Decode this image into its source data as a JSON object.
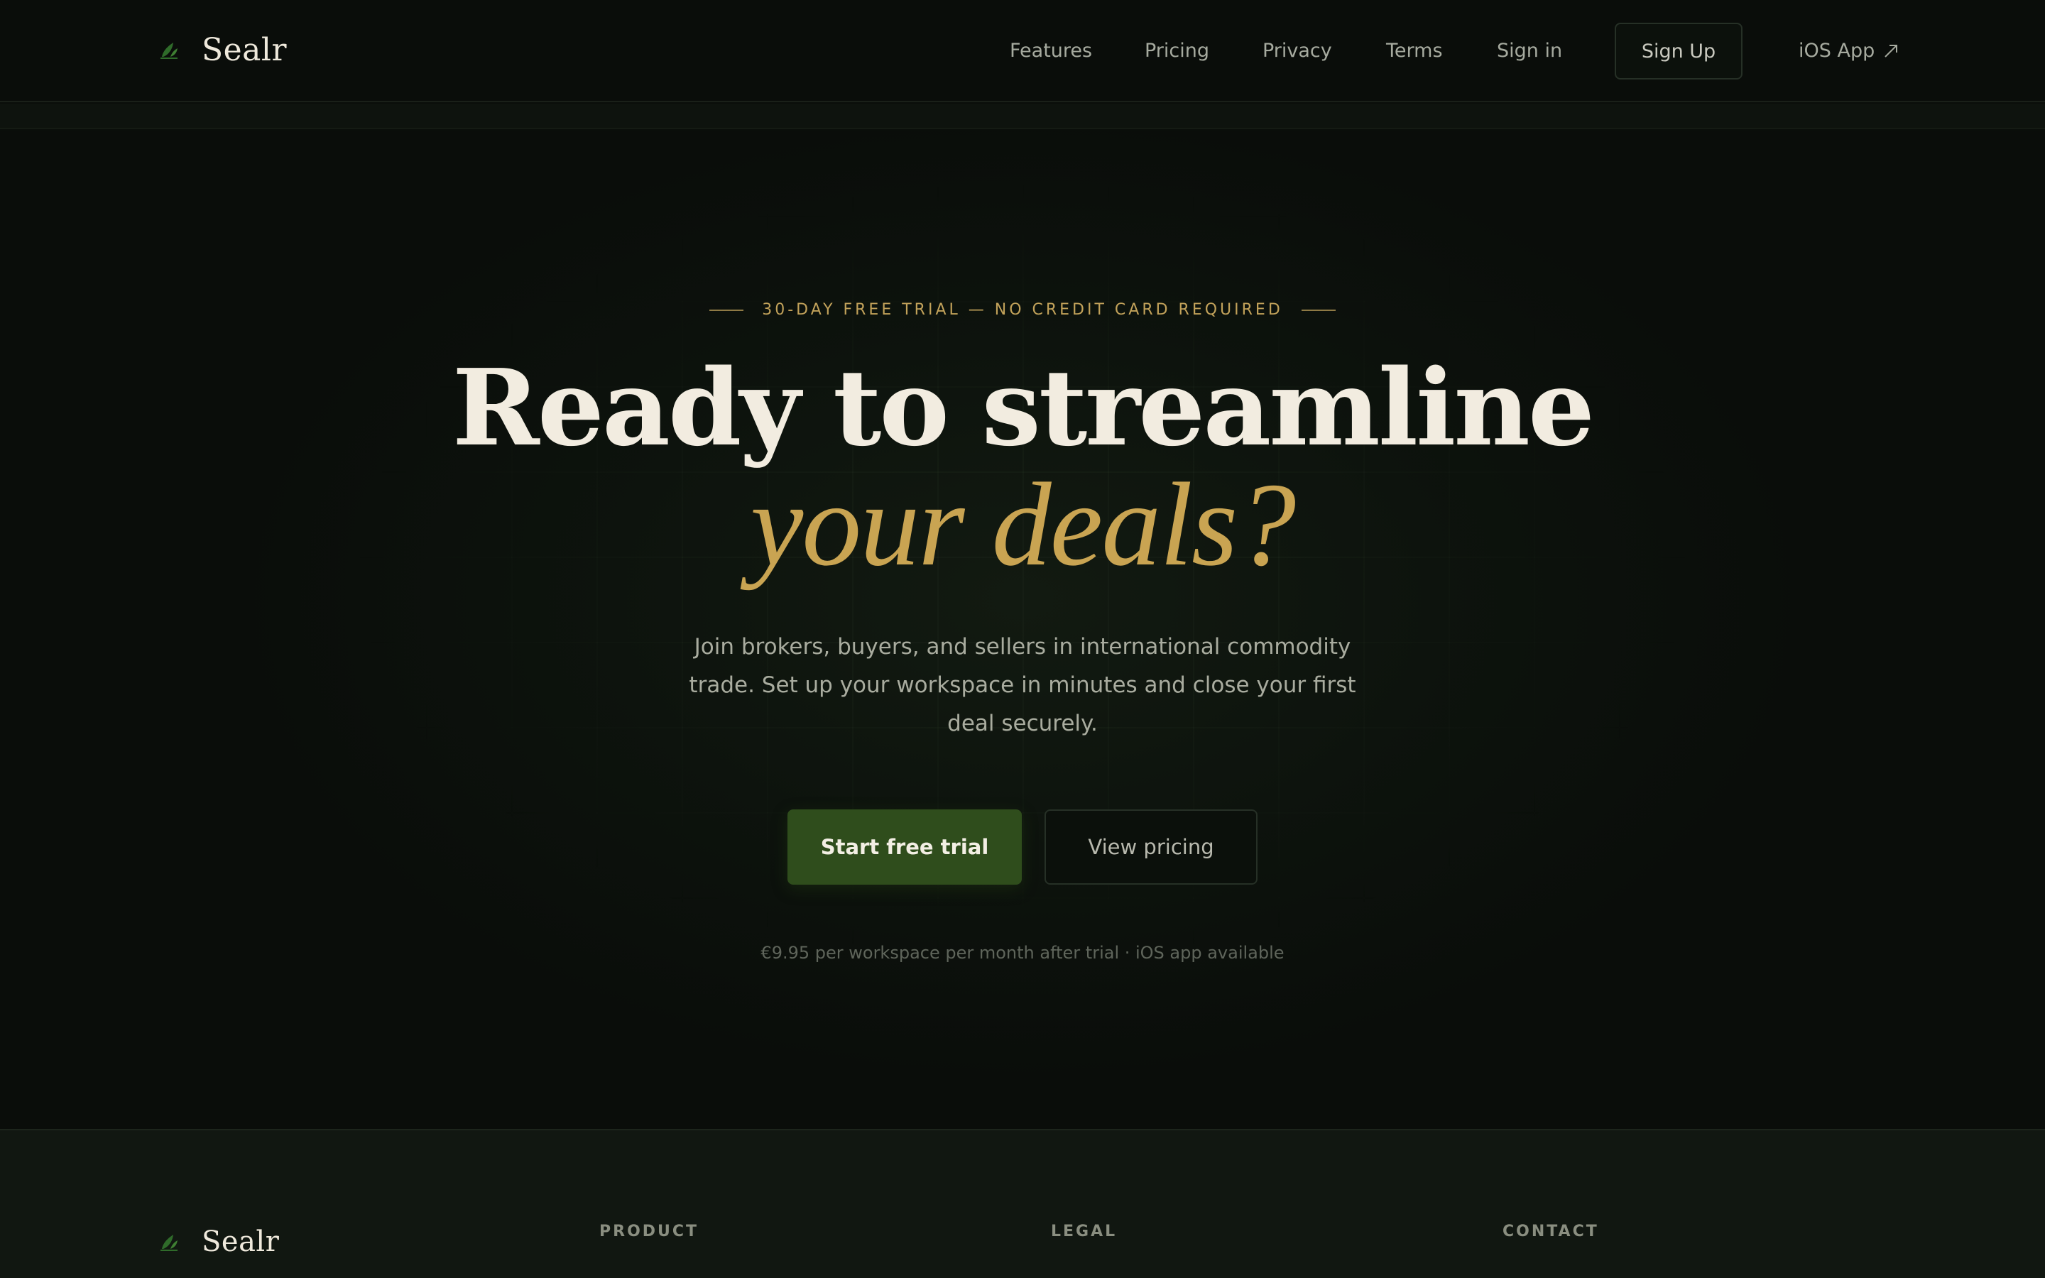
{
  "nav": {
    "brand": "Sealr",
    "links": {
      "features": "Features",
      "pricing": "Pricing",
      "privacy": "Privacy",
      "terms": "Terms",
      "signin": "Sign in"
    },
    "signup_label": "Sign Up",
    "ios_label": "iOS App"
  },
  "hero": {
    "eyebrow": "30-DAY FREE TRIAL — NO CREDIT CARD REQUIRED",
    "headline": "Ready to streamline",
    "headline_accent": "your deals?",
    "subtext": "Join brokers, buyers, and sellers in international commodity trade. Set up your workspace in minutes and close your first deal securely.",
    "primary_cta": "Start free trial",
    "secondary_cta": "View pricing",
    "fineprint": "€9.95 per workspace per month after trial · iOS app available"
  },
  "footer": {
    "brand": "Sealr",
    "columns": {
      "product": "PRODUCT",
      "legal": "LEGAL",
      "contact": "CONTACT"
    }
  },
  "colors": {
    "background": "#0a0d0a",
    "accent_gold": "#c9a452",
    "primary_green": "#2f4d1c",
    "brand_leaf": "#2f6b2a"
  },
  "icons": {
    "brand": "leaf-logo-icon",
    "external": "arrow-up-right-icon"
  }
}
